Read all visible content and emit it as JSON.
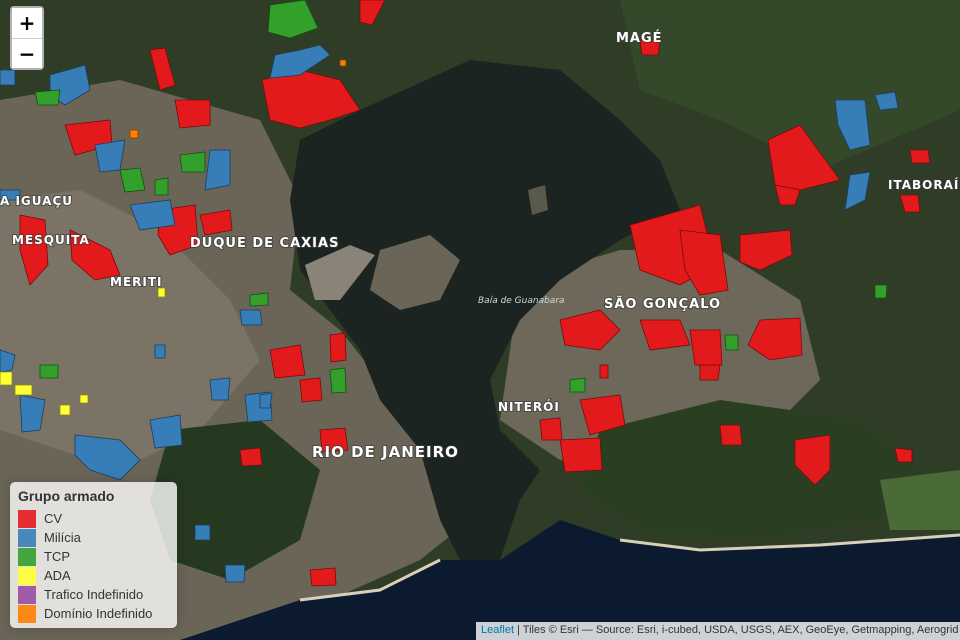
{
  "zoom": {
    "in_label": "+",
    "out_label": "−"
  },
  "legend": {
    "title": "Grupo armado",
    "items": [
      {
        "label": "CV",
        "color": "#e31a1c"
      },
      {
        "label": "Milícia",
        "color": "#377eb8"
      },
      {
        "label": "TCP",
        "color": "#33a02c"
      },
      {
        "label": "ADA",
        "color": "#ffff33"
      },
      {
        "label": "Trafico Indefinido",
        "color": "#984ea3"
      },
      {
        "label": "Domínio Indefinido",
        "color": "#ff7f00"
      }
    ]
  },
  "places": {
    "mage": "MAGÉ",
    "itaborai": "ITABORAÍ",
    "nova_iguacu": "A IGUAÇU",
    "mesquita": "MESQUITA",
    "caxias": "DUQUE DE CAXIAS",
    "merit": "MERITI",
    "bay": "Baía de Guanabara",
    "sao_goncalo": "SÃO GONÇALO",
    "niteroi": "NITERÓI",
    "rio": "RIO DE JANEIRO"
  },
  "attribution": {
    "leaflet": "Leaflet",
    "text": " | Tiles © Esri — Source: Esri, i-cubed, USDA, USGS, AEX, GeoEye, Getmapping, Aerogrid"
  }
}
